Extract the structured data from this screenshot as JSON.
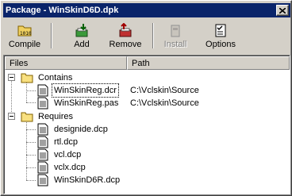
{
  "window": {
    "title": "Package - WinSkinD6D.dpk"
  },
  "toolbar": {
    "compile": "Compile",
    "add": "Add",
    "remove": "Remove",
    "install": "Install",
    "options": "Options"
  },
  "columns": {
    "files": "Files",
    "path": "Path"
  },
  "tree": {
    "contains": {
      "label": "Contains",
      "items": [
        {
          "name": "WinSkinReg.dcr",
          "path": "C:\\Vclskin\\Source"
        },
        {
          "name": "WinSkinReg.pas",
          "path": "C:\\Vclskin\\Source"
        }
      ]
    },
    "requires": {
      "label": "Requires",
      "items": [
        {
          "name": "designide.dcp"
        },
        {
          "name": "rtl.dcp"
        },
        {
          "name": "vcl.dcp"
        },
        {
          "name": "vclx.dcp"
        },
        {
          "name": "WinSkinD6R.dcp"
        }
      ]
    }
  }
}
